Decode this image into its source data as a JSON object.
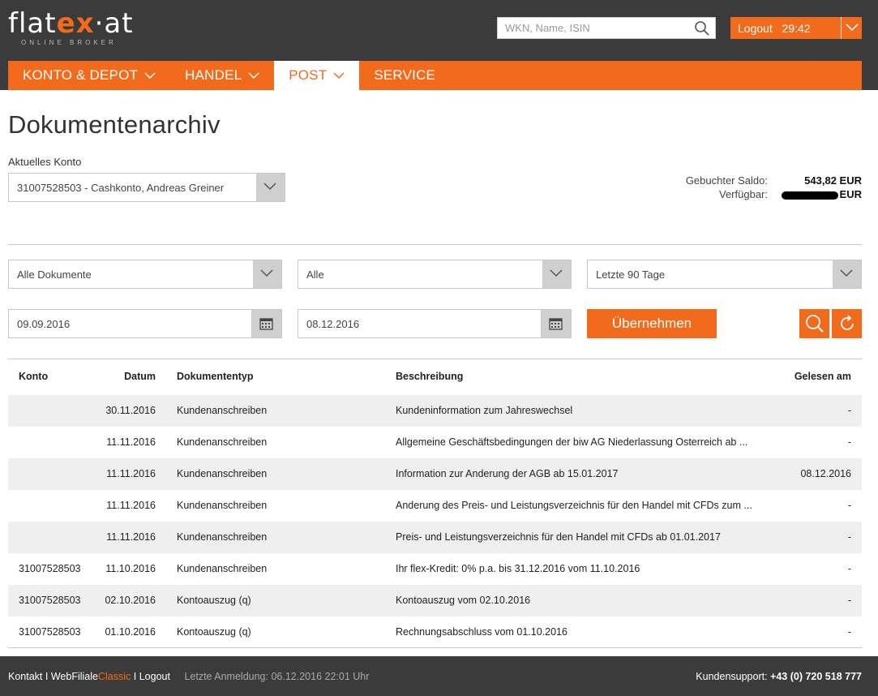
{
  "header": {
    "logo_main": "flatex",
    "logo_ex": "ex",
    "logo_suffix": "·at",
    "logo_sub": "ONLINE BROKER",
    "search_placeholder": "WKN, Name, ISIN",
    "logout_label": "Logout",
    "session_timer": "29:42",
    "accent_color": "#f26b1d",
    "bar_color": "#3b3b3b"
  },
  "nav": {
    "items": [
      {
        "label": "KONTO & DEPOT",
        "has_dropdown": true,
        "active": false
      },
      {
        "label": "HANDEL",
        "has_dropdown": true,
        "active": false
      },
      {
        "label": "POST",
        "has_dropdown": true,
        "active": true
      },
      {
        "label": "SERVICE",
        "has_dropdown": false,
        "active": false
      }
    ]
  },
  "page": {
    "title": "Dokumentenarchiv",
    "account_label": "Aktuelles Konto",
    "account_value": "31007528503 - Cashkonto, Andreas Greiner",
    "saldo_label": "Gebuchter Saldo:",
    "saldo_value": "543,82 EUR",
    "verfuegbar_label": "Verfügbar:",
    "verfuegbar_currency": "EUR"
  },
  "filters": {
    "document_type": "Alle Dokumente",
    "status": "Alle",
    "period": "Letzte 90 Tage",
    "date_from": "09.09.2016",
    "date_to": "08.12.2016",
    "apply_label": "Übernehmen"
  },
  "table": {
    "headers": {
      "konto": "Konto",
      "datum": "Datum",
      "typ": "Dokumententyp",
      "beschreibung": "Beschreibung",
      "gelesen": "Gelesen am"
    },
    "rows": [
      {
        "konto": "",
        "datum": "30.11.2016",
        "typ": "Kundenanschreiben",
        "beschreibung": "Kundeninformation zum Jahreswechsel",
        "gelesen": "-"
      },
      {
        "konto": "",
        "datum": "11.11.2016",
        "typ": "Kundenanschreiben",
        "beschreibung": "Allgemeine Geschäftsbedingungen der biw AG Niederlassung Osterreich ab ...",
        "gelesen": "-"
      },
      {
        "konto": "",
        "datum": "11.11.2016",
        "typ": "Kundenanschreiben",
        "beschreibung": "Information zur Anderung der AGB ab 15.01.2017",
        "gelesen": "08.12.2016"
      },
      {
        "konto": "",
        "datum": "11.11.2016",
        "typ": "Kundenanschreiben",
        "beschreibung": "Anderung des Preis- und Leistungsverzeichnis für den Handel mit CFDs zum ...",
        "gelesen": "-"
      },
      {
        "konto": "",
        "datum": "11.11.2016",
        "typ": "Kundenanschreiben",
        "beschreibung": "Preis- und Leistungsverzeichnis für den Handel mit CFDs ab 01.01.2017",
        "gelesen": "-"
      },
      {
        "konto": "31007528503",
        "datum": "11.10.2016",
        "typ": "Kundenanschreiben",
        "beschreibung": "Ihr flex-Kredit: 0% p.a. bis 31.12.2016 vom 11.10.2016",
        "gelesen": "-"
      },
      {
        "konto": "31007528503",
        "datum": "02.10.2016",
        "typ": "Kontoauszug (q)",
        "beschreibung": "Kontoauszug vom 02.10.2016",
        "gelesen": "-"
      },
      {
        "konto": "31007528503",
        "datum": "01.10.2016",
        "typ": "Kontoauszug (q)",
        "beschreibung": "Rechnungsabschluss vom 01.10.2016",
        "gelesen": "-"
      }
    ]
  },
  "footer": {
    "kontakt": "Kontakt",
    "sep": "I",
    "webfiliale": "WebFiliale",
    "classic": "Classic",
    "logout": "Logout",
    "last_login": "Letzte Anmeldung: 06.12.2016 22:01 Uhr",
    "support_label": "Kundensupport:",
    "support_phone": "+43 (0) 720 518 777"
  }
}
